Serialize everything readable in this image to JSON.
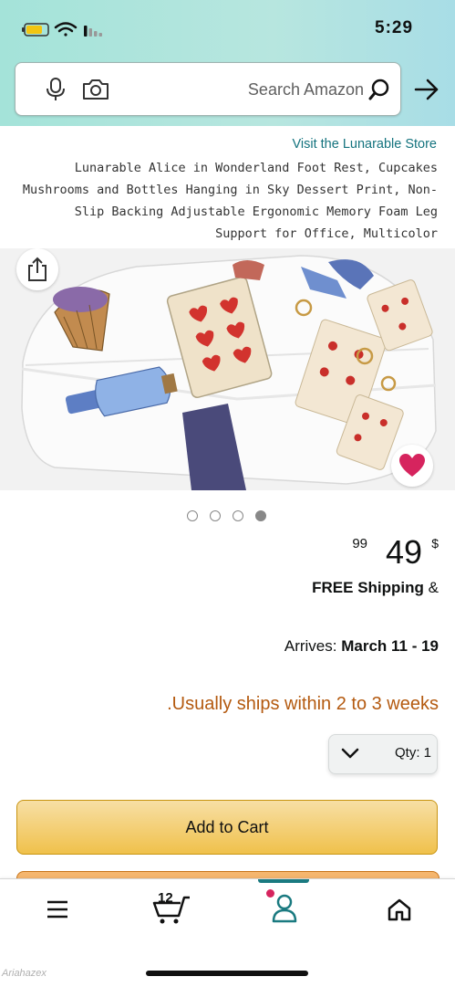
{
  "status_bar": {
    "time": "5:29",
    "icons": [
      "battery-icon",
      "wifi-icon",
      "signal-icon"
    ],
    "battery_color": "#f2c511"
  },
  "search": {
    "placeholder": "Search Amazon",
    "icons": [
      "search-icon",
      "camera-icon",
      "microphone-icon",
      "back-arrow-icon"
    ]
  },
  "product": {
    "store_link": "Visit the Lunarable Store",
    "title": "Lunarable Alice in Wonderland Foot Rest, Cupcakes Mushrooms and Bottles Hanging in Sky Dessert Print, Non-Slip Backing Adjustable Ergonomic Memory Foam Leg Support for Office, Multicolor",
    "image_count": 4,
    "active_image_index": 3,
    "price": {
      "symbol": "$",
      "whole": "49",
      "fraction": "99"
    },
    "shipping_prefix": "&",
    "shipping_bold": "FREE Shipping",
    "arrives_label": "Arrives:",
    "arrives_date": "March 11 - 19",
    "availability": "Usually ships within 2 to 3 weeks.",
    "qty_label": "Qty: 1",
    "add_to_cart": "Add to Cart"
  },
  "tabbar": {
    "items": [
      "home-icon",
      "account-icon",
      "cart-icon",
      "menu-icon"
    ],
    "cart_count": "12",
    "active": "account-icon"
  },
  "watermark": "Ariahazex",
  "colors": {
    "header_gradient_start": "#a4e3d9",
    "header_gradient_end": "#a8dde6",
    "link": "#14737e",
    "availability": "#b45a10",
    "add_to_cart": "#f0c14b",
    "buy_now": "#f5b66e",
    "accent": "#1a7a80",
    "wishlist_heart": "#d6245e"
  }
}
